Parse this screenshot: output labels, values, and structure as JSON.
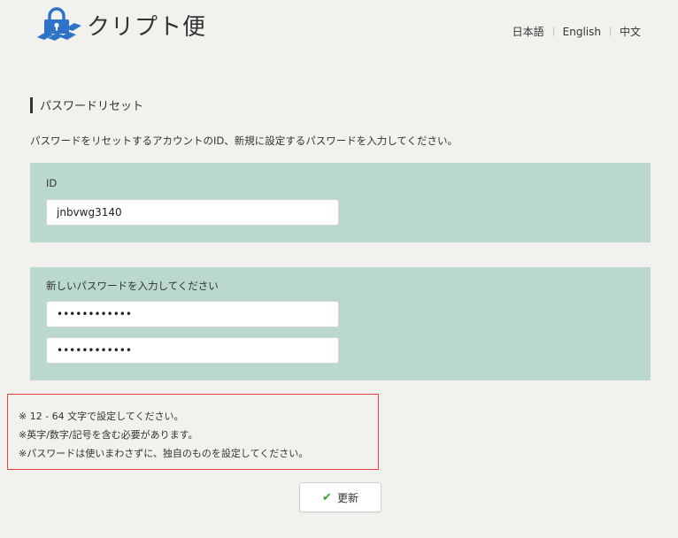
{
  "header": {
    "logo_text": "クリプト便",
    "languages": [
      "日本語",
      "English",
      "中文"
    ]
  },
  "page": {
    "section_title": "パスワードリセット",
    "description": "パスワードをリセットするアカウントのID、新規に設定するパスワードを入力してください。"
  },
  "id_panel": {
    "label": "ID",
    "value": "jnbvwg3140"
  },
  "password_panel": {
    "label": "新しいパスワードを入力してください",
    "password_value": "••••••••••••",
    "confirm_value": "••••••••••••"
  },
  "notes": [
    "※ 12 - 64 文字で設定してください。",
    "※英字/数字/記号を含む必要があります。",
    "※パスワードは使いまわさずに、独自のものを設定してください。"
  ],
  "update_button": {
    "icon": "check-icon",
    "label": "更新"
  },
  "colors": {
    "background": "#f2f1ed",
    "panel": "#bbd8d0",
    "logo_blue": "#2f73c9",
    "highlight_border": "#e1473b",
    "check_green": "#3d9c3a"
  }
}
